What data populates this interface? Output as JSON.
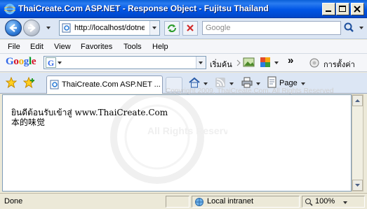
{
  "window": {
    "title": "ThaiCreate.Com ASP.NET - Response Object - Fujitsu Thailand"
  },
  "address_bar": {
    "url": "http://localhost/dotne",
    "search_placeholder": "Google"
  },
  "menu": [
    "File",
    "Edit",
    "View",
    "Favorites",
    "Tools",
    "Help"
  ],
  "google_toolbar": {
    "logo": "Google",
    "search_label": "เริ่มค้น",
    "settings_label": "การตั้งค่า",
    "more_glyph": "»"
  },
  "tab": {
    "title": "ThaiCreate.Com ASP.NET ...",
    "page_menu": "Page"
  },
  "content": {
    "line1": "ยินดีต้อนรับเข้าสู่ www.ThaiCreate.Com",
    "line2": "本的味觉",
    "watermark": "All Rights Reserved",
    "copyright": "Copyright 2009, ThaiCreate.Com. All Rights Reserved"
  },
  "status": {
    "text": "Done",
    "zone": "Local intranet",
    "zoom": "100%"
  },
  "colors": {
    "title_bar": "#0055e5",
    "chrome": "#dce6f4",
    "menu_bg": "#f5f6f9"
  }
}
